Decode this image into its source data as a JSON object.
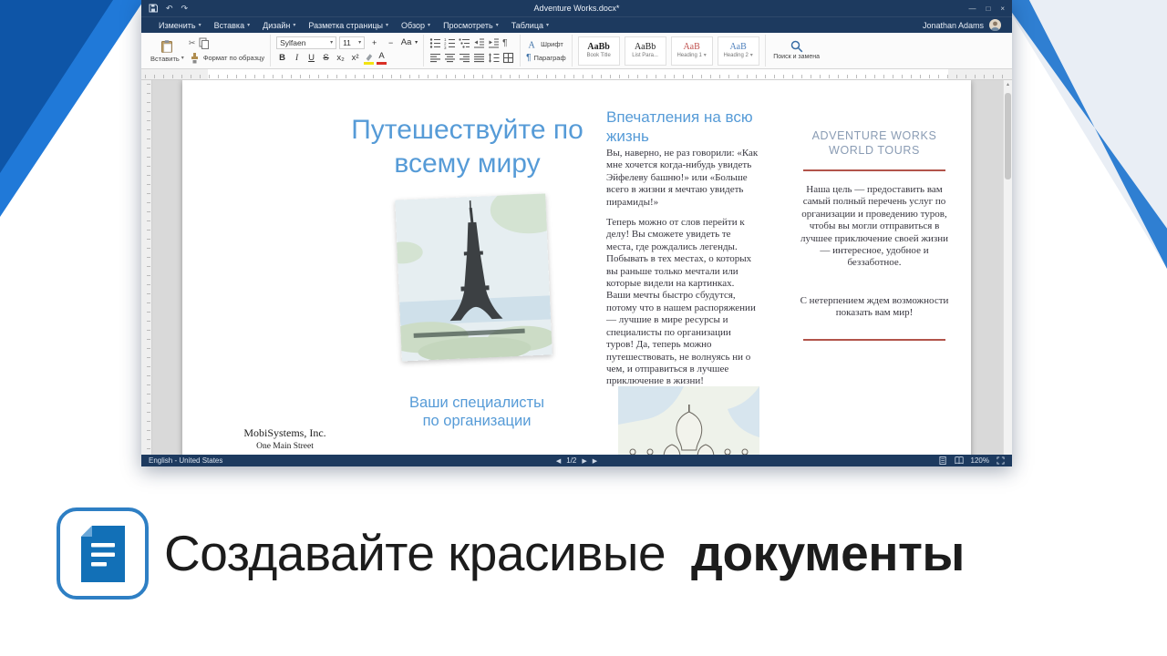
{
  "colors": {
    "titlebar": "#1d3a5f",
    "accent_blue": "#569bd7",
    "brand_blue": "#2e7fc4",
    "rule_red": "#b2544a",
    "heading_gray_blue": "#8a9cb4",
    "heading1_style": "#c0504d"
  },
  "titlebar": {
    "title": "Adventure Works.docx*"
  },
  "menu": {
    "items": [
      "Изменить",
      "Вставка",
      "Дизайн",
      "Разметка страницы",
      "Обзор",
      "Просмотреть",
      "Таблица"
    ],
    "user": "Jonathan Adams"
  },
  "ribbon": {
    "paste": "Вставить",
    "format_painter": "Формат по образцу",
    "font_name": "Sylfaen",
    "font_size": "11",
    "grow": "+",
    "shrink": "−",
    "change_case": "Aa",
    "bold": "B",
    "italic": "I",
    "underline": "U",
    "strike": "S",
    "subscript": "x₂",
    "superscript": "x²",
    "font_color_letter": "A",
    "font_dialog": "Шрифт",
    "paragraph_dialog": "Параграф",
    "styles": [
      {
        "preview": "AaBb",
        "label": "Book Title"
      },
      {
        "preview": "AaBb",
        "label": "List Para..."
      },
      {
        "preview": "AaB",
        "label": "Heading 1"
      },
      {
        "preview": "AaB",
        "label": "Heading 2"
      }
    ],
    "find_replace": "Поиск и замена"
  },
  "statusbar": {
    "language": "English - United States",
    "page": "1/2",
    "zoom": "120%"
  },
  "doc": {
    "headline": "Путешествуйте по всему миру",
    "experiences_heading": "Впечатления на всю жизнь",
    "experiences_para1": "Вы, наверно, не раз говорили: «Как мне хочется когда-нибудь увидеть Эйфелеву башню!» или «Больше всего в жизни я мечтаю увидеть пирамиды!»",
    "experiences_para2": "Теперь можно от слов перейти к делу! Вы сможете увидеть те места, где рождались легенды. Побывать в тех местах, о которых вы раньше только мечтали или которые видели на картинках. Ваши мечты быстро сбудутся, потому что в нашем распоряжении — лучшие в мире ресурсы и специалисты по организации туров! Да, теперь можно путешествовать, не волнуясь ни о чем, и отправиться в лучшее приключение в жизни!",
    "specialists_heading": "Ваши специалисты по организации",
    "company_name": "MobiSystems, Inc.",
    "company_address": "One Main Street",
    "brand_heading": "ADVENTURE WORKS WORLD TOURS",
    "brand_para1": "Наша цель — предоставить вам самый полный перечень услуг по организации и проведению туров, чтобы вы могли отправиться в лучшее приключение своей жизни — интересное, удобное и беззаботное.",
    "brand_para2": "С нетерпением ждем возможности показать вам мир!"
  },
  "promo": {
    "regular": "Создавайте красивые",
    "bold": "документы"
  },
  "icons": {
    "caret": "▾",
    "undo": "↶",
    "redo": "↷",
    "scissors": "✂",
    "pilcrow": "¶",
    "prev": "◀",
    "next": "▶",
    "minimize": "—",
    "maximize": "□",
    "close": "×",
    "scroll_up": "▴"
  }
}
